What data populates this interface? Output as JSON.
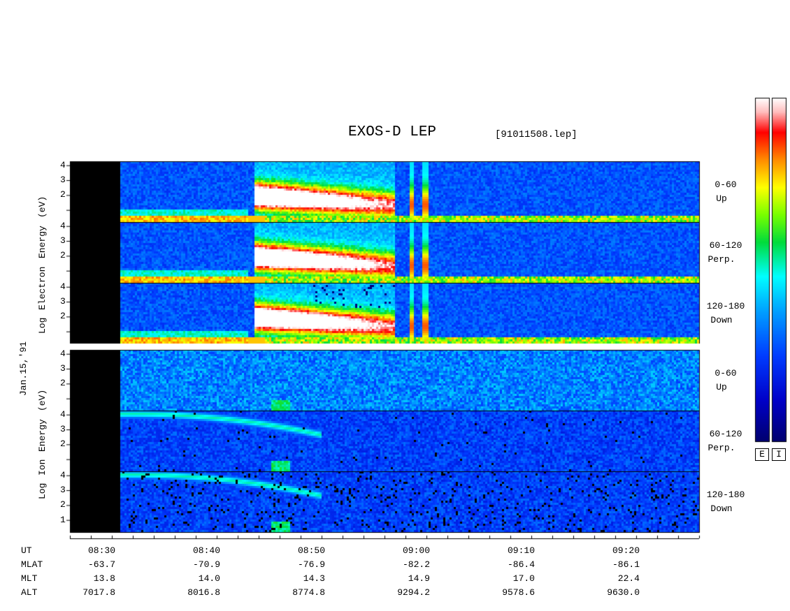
{
  "title": "EXOS-D LEP",
  "file_label": "[91011508.lep]",
  "date_label": "Jan.15,'91",
  "colorbar": {
    "labels": [
      "E",
      "I"
    ],
    "colors": [
      "#ffffff",
      "#ffd0d0",
      "#ff0000",
      "#ff8000",
      "#ffff00",
      "#80ff00",
      "#00c000",
      "#00ffff",
      "#0080ff",
      "#0000ff",
      "#000080"
    ]
  },
  "chart_data": {
    "type": "heatmap",
    "description_fields": {
      "x_axis": "UT",
      "x_ticks": [
        "08:30",
        "08:40",
        "08:50",
        "09:00",
        "09:10",
        "09:20"
      ],
      "orbit_rows": [
        {
          "label": "UT",
          "values": [
            "08:30",
            "08:40",
            "08:50",
            "09:00",
            "09:10",
            "09:20"
          ]
        },
        {
          "label": "MLAT",
          "values": [
            "-63.7",
            "-70.9",
            "-76.9",
            "-82.2",
            "-86.4",
            "-86.1"
          ]
        },
        {
          "label": "MLT",
          "values": [
            "13.8",
            "14.0",
            "14.3",
            "14.9",
            "17.0",
            "22.4"
          ]
        },
        {
          "label": "ALT",
          "values": [
            "7017.8",
            "8016.8",
            "8774.8",
            "9294.2",
            "9578.6",
            "9630.0"
          ]
        }
      ]
    },
    "groups": [
      {
        "species": "Electron",
        "ylabel_words": [
          "Log",
          "Electron",
          "Energy",
          "(eV)"
        ],
        "panels": [
          {
            "pitch_label": "0-60",
            "direction_label": "Up",
            "yticks": [
              "4",
              "3",
              "2"
            ]
          },
          {
            "pitch_label": "60-120",
            "direction_label": "Perp.",
            "yticks": [
              "4",
              "3",
              "2"
            ]
          },
          {
            "pitch_label": "120-180",
            "direction_label": "Down",
            "yticks": [
              "4",
              "3",
              "2"
            ]
          }
        ]
      },
      {
        "species": "Ion",
        "ylabel_words": [
          "Log",
          "Ion",
          "Energy",
          "(eV)"
        ],
        "panels": [
          {
            "pitch_label": "0-60",
            "direction_label": "Up",
            "yticks": [
              "4",
              "3",
              "2"
            ]
          },
          {
            "pitch_label": "60-120",
            "direction_label": "Perp.",
            "yticks": [
              "4",
              "3",
              "2"
            ]
          },
          {
            "pitch_label": "120-180",
            "direction_label": "Down",
            "yticks": [
              "4",
              "3",
              "2",
              "1"
            ]
          }
        ]
      }
    ],
    "xlim_minutes_UT": [
      "08:27",
      "09:27"
    ],
    "data_gap_until": "08:33"
  }
}
